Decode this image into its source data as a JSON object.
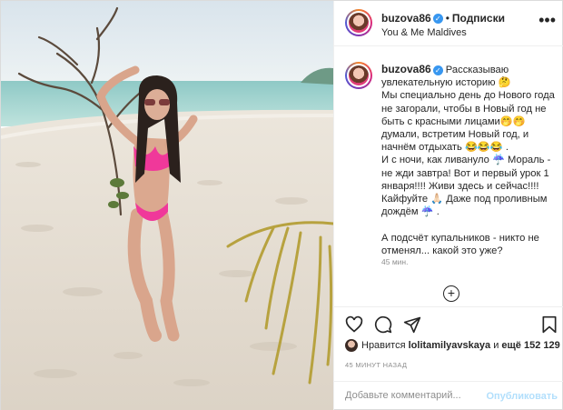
{
  "post": {
    "author": {
      "username": "buzova86",
      "verified_icon": "verified-badge-icon",
      "follow_label": "Подписки",
      "separator": "•",
      "location": "You & Me Maldives"
    },
    "more_icon": "more-options-icon",
    "caption": {
      "username": "buzova86",
      "text": "Рассказываю увлекательную историю 🤔\nМы специально день до Нового года не загорали, чтобы в Новый год не быть с красными лицами🤭🤭 думали, встретим Новый год, и начнём отдыхать 😂😂😂 .\nИ с ночи, как ливануло ☔ Мораль - не жди завтра! Вот и первый урок 1 января!!!! Живи здесь и сейчас!!!! Кайфуйте 🙏🏻 Даже под проливным дождём ☔ .\n\nА подсчёт купальников - никто не отменял... какой это уже?",
      "time": "45 мин."
    },
    "add_comment_icon": "plus-circle-icon",
    "actions": {
      "like_icon": "heart-icon",
      "comment_icon": "comment-icon",
      "share_icon": "share-icon",
      "save_icon": "bookmark-icon"
    },
    "likes": {
      "prefix": "Нравится",
      "liker": "lolitamilyavskaya",
      "conjunction": "и",
      "others": "ещё 152 129"
    },
    "timestamp": "45 МИНУТ НАЗАД",
    "comment": {
      "placeholder": "Добавьте комментарий...",
      "publish_label": "Опубликовать"
    },
    "colors": {
      "accent_blue": "#3897f0",
      "publish_disabled": "#b2dffc",
      "swimsuit_pink": "#f0389a"
    }
  }
}
